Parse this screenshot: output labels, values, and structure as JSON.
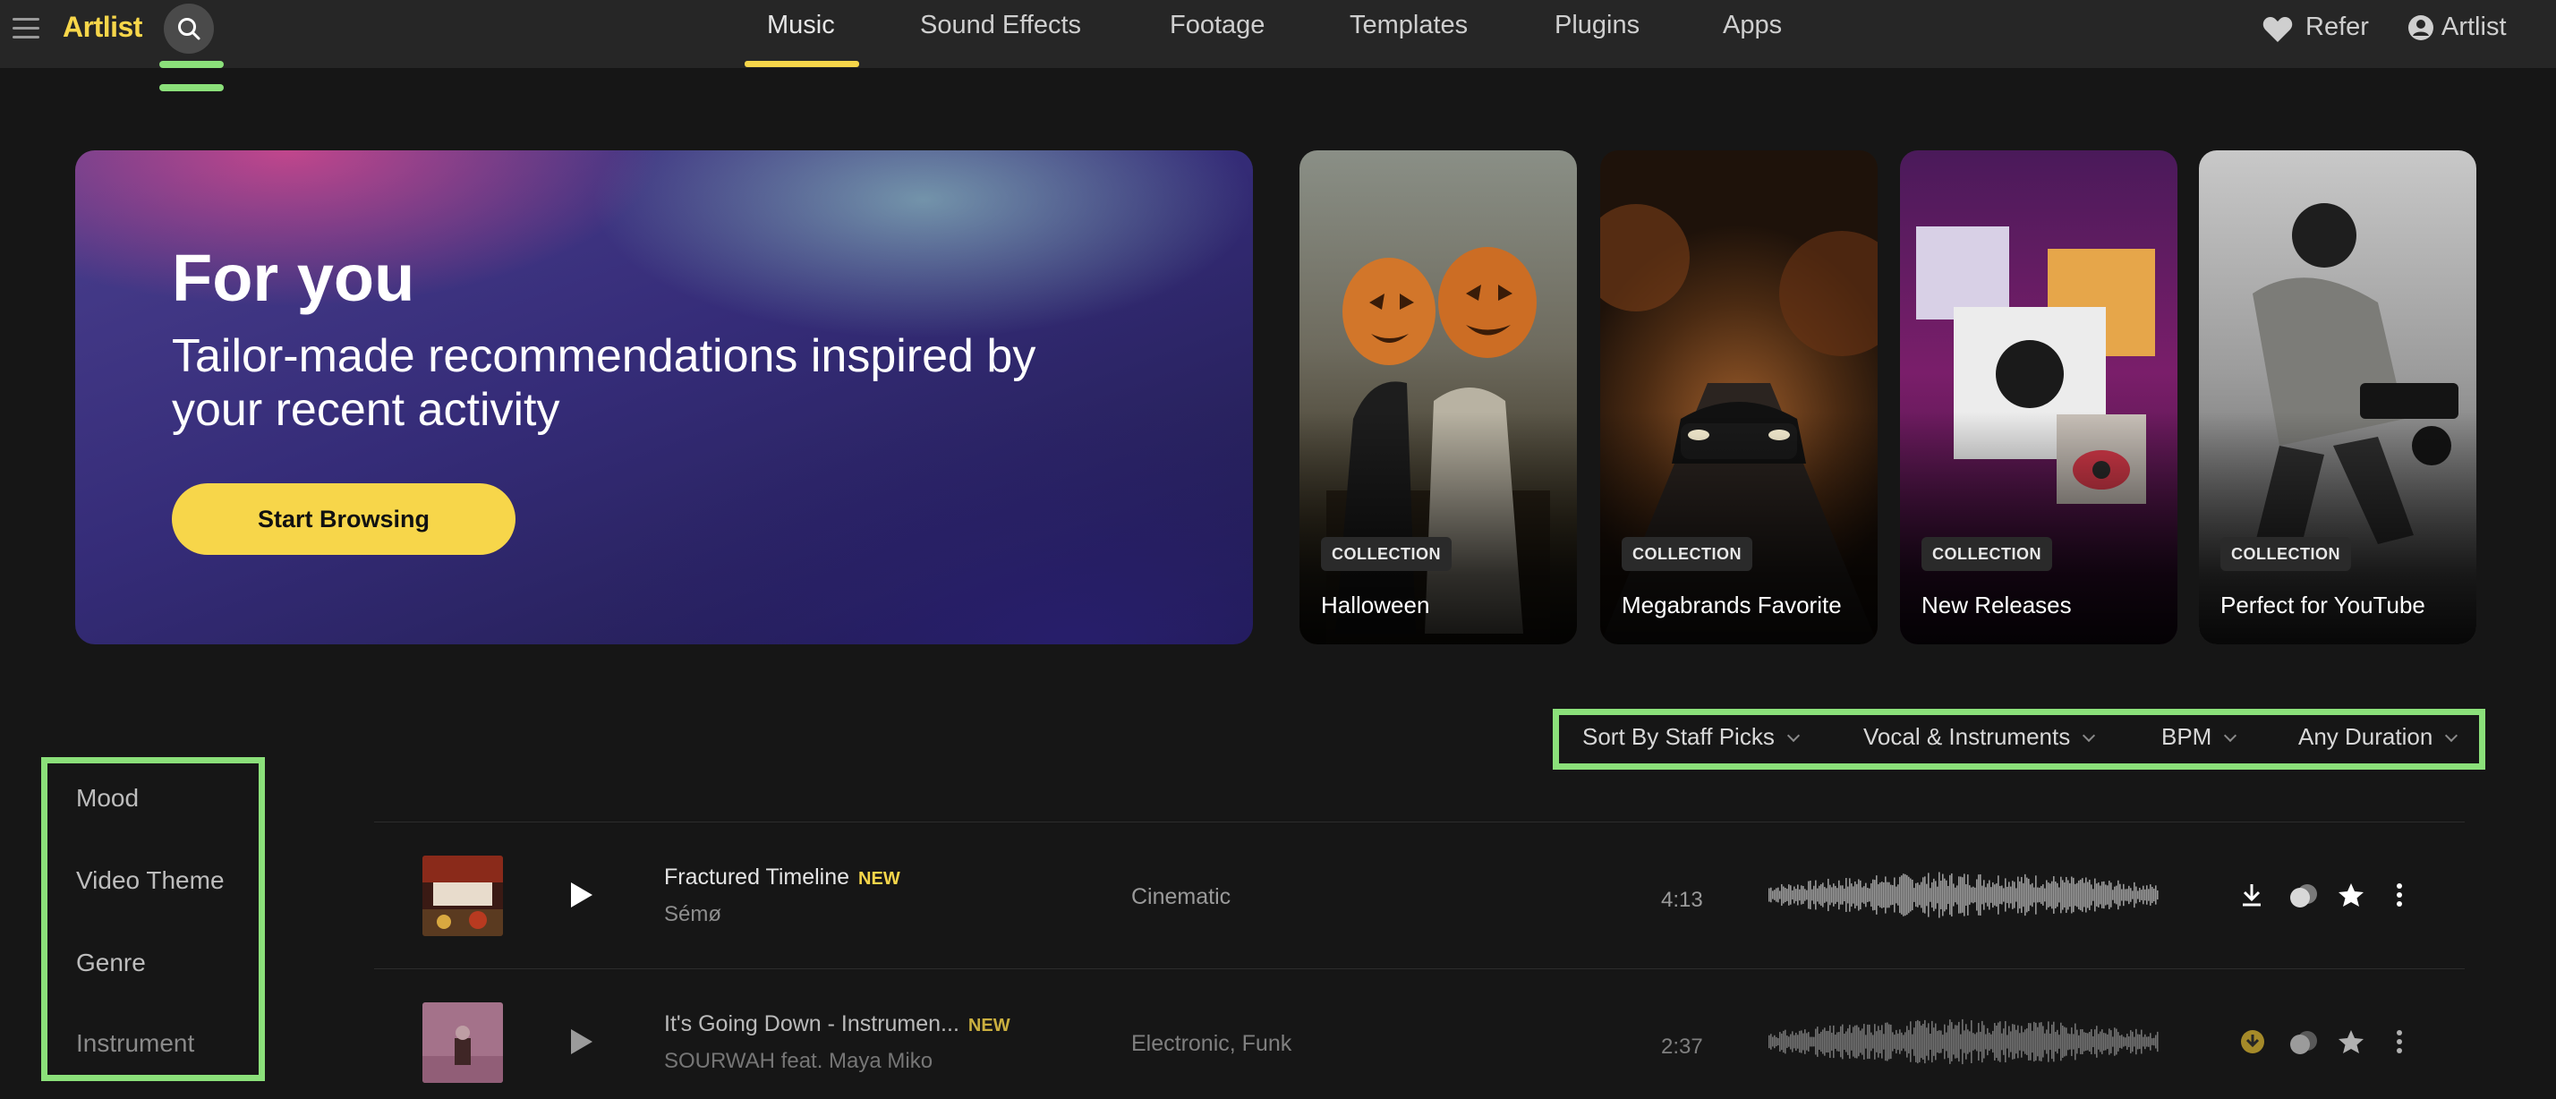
{
  "header": {
    "logo": "Artlist",
    "nav": [
      {
        "label": "Music",
        "active": true
      },
      {
        "label": "Sound Effects",
        "active": false
      },
      {
        "label": "Footage",
        "active": false
      },
      {
        "label": "Templates",
        "active": false
      },
      {
        "label": "Plugins",
        "active": false
      },
      {
        "label": "Apps",
        "active": false
      }
    ],
    "refer_label": "Refer",
    "account_label": "Artlist",
    "accent_color": "#f7d64a"
  },
  "hero": {
    "title": "For you",
    "subtitle": "Tailor-made recommendations inspired by your recent activity",
    "button_label": "Start Browsing"
  },
  "collections": [
    {
      "badge": "COLLECTION",
      "title": "Halloween"
    },
    {
      "badge": "COLLECTION",
      "title": "Megabrands Favorite"
    },
    {
      "badge": "COLLECTION",
      "title": "New Releases"
    },
    {
      "badge": "COLLECTION",
      "title": "Perfect for YouTube"
    }
  ],
  "filters": [
    {
      "label": "Sort By Staff Picks"
    },
    {
      "label": "Vocal & Instruments"
    },
    {
      "label": "BPM"
    },
    {
      "label": "Any Duration"
    }
  ],
  "categories": [
    "Mood",
    "Video Theme",
    "Genre",
    "Instrument"
  ],
  "tracks": [
    {
      "title": "Fractured Timeline",
      "badge": "NEW",
      "artist": "Sémø",
      "genre": "Cinematic",
      "duration": "4:13"
    },
    {
      "title": "It's Going Down - Instrumen...",
      "badge": "NEW",
      "artist": "SOURWAH feat. Maya Miko",
      "genre": "Electronic,  Funk",
      "duration": "2:37"
    }
  ]
}
